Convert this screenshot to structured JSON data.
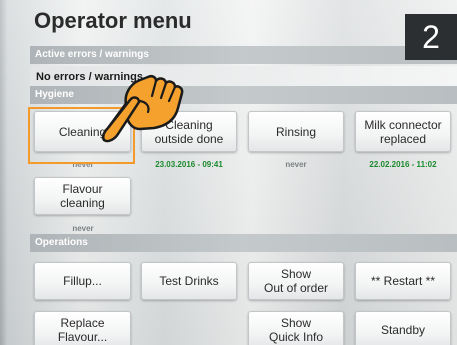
{
  "title": "Operator menu",
  "step_badge": "2",
  "sections": {
    "errors": "Active errors / warnings",
    "hygiene": "Hygiene",
    "operations": "Operations"
  },
  "errors_text": "No errors / warnings",
  "hygiene": {
    "cleaning": {
      "label": "Cleaning",
      "status": "never"
    },
    "cleaning_outside": {
      "label": "Cleaning\noutside done",
      "status": "23.03.2016 - 09:41"
    },
    "rinsing": {
      "label": "Rinsing",
      "status": "never"
    },
    "milk_connector": {
      "label": "Milk connector\nreplaced",
      "status": "22.02.2016 - 11:02"
    },
    "flavour_cleaning": {
      "label": "Flavour\ncleaning",
      "status": "never"
    }
  },
  "operations": {
    "fillup": "Fillup...",
    "test_drinks": "Test Drinks",
    "show_out_of_order": "Show\nOut of order",
    "restart": "** Restart **",
    "replace_flavour": "Replace\nFlavour...",
    "show_quick_info": "Show\nQuick Info",
    "standby": "Standby"
  },
  "colors": {
    "highlight": "#f39a2b",
    "hand": "#f5a12d",
    "status_green": "#1a8a2c",
    "badge_bg": "#2c2f31"
  },
  "icons": {
    "pointer": "pointing-hand-icon"
  }
}
